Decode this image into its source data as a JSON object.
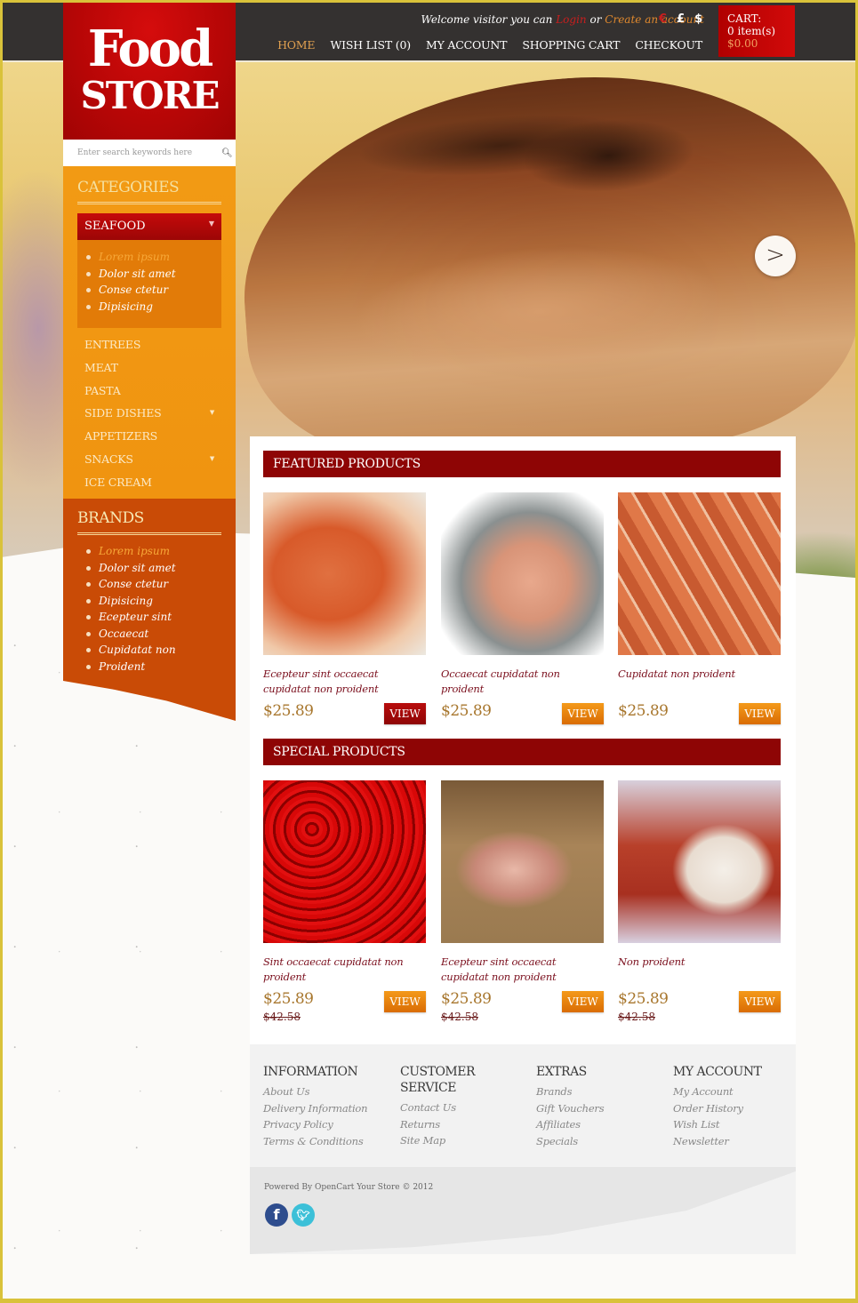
{
  "header": {
    "logo_line1": "Food",
    "logo_line2": "STORE",
    "welcome_text": "Welcome visitor you can",
    "login_link": "Login",
    "or_text": "or",
    "create_account_link": "Create an account",
    "currencies": [
      "€",
      "£",
      "$"
    ],
    "currency_colors": {
      "active": "#c81e1e",
      "inactive": "#ffffff"
    },
    "nav": [
      {
        "label": "HOME",
        "active": true
      },
      {
        "label": "WISH LIST (0)",
        "active": false
      },
      {
        "label": "MY ACCOUNT",
        "active": false
      },
      {
        "label": "SHOPPING CART",
        "active": false
      },
      {
        "label": "CHECKOUT",
        "active": false
      }
    ],
    "cart": {
      "label": "CART:",
      "items": "0 item(s)",
      "total": "$0.00"
    }
  },
  "search": {
    "placeholder": "Enter search keywords here",
    "icon": "search-icon"
  },
  "hero": {
    "next_label": ">"
  },
  "categories": {
    "title": "CATEGORIES",
    "active": {
      "label": "SEAFOOD",
      "icon": "chevron-down-icon"
    },
    "subitems": [
      "Lorem ipsum",
      "Dolor sit amet",
      "Conse ctetur",
      "Dipisicing"
    ],
    "items": [
      {
        "label": "ENTREES",
        "has_children": false
      },
      {
        "label": "MEAT",
        "has_children": false
      },
      {
        "label": "PASTA",
        "has_children": false
      },
      {
        "label": "SIDE DISHES",
        "has_children": true
      },
      {
        "label": "APPETIZERS",
        "has_children": false
      },
      {
        "label": "SNACKS",
        "has_children": true
      },
      {
        "label": "ICE CREAM",
        "has_children": false
      }
    ]
  },
  "brands": {
    "title": "BRANDS",
    "items": [
      "Lorem ipsum",
      "Dolor sit amet",
      "Conse ctetur",
      "Dipisicing",
      "Ecepteur sint",
      "Occaecat",
      "Cupidatat non",
      "Proident"
    ]
  },
  "featured": {
    "title": "FEATURED PRODUCTS",
    "products": [
      {
        "name": "Ecepteur sint occaecat cupidatat non proident",
        "price": "$25.89",
        "button": "VIEW",
        "image": "shrimp dish"
      },
      {
        "name": "Occaecat cupidatat non proident",
        "price": "$25.89",
        "button": "VIEW",
        "image": "grilled salmon steak"
      },
      {
        "name": "Cupidatat non proident",
        "price": "$25.89",
        "button": "VIEW",
        "image": "bacon wrapped rolls"
      }
    ]
  },
  "special": {
    "title": "SPECIAL PRODUCTS",
    "products": [
      {
        "name": "Sint occaecat cupidatat non proident",
        "price": "$25.89",
        "old_price": "$42.58",
        "button": "VIEW",
        "image": "red chili peppers"
      },
      {
        "name": "Ecepteur sint occaecat cupidatat non proident",
        "price": "$25.89",
        "old_price": "$42.58",
        "button": "VIEW",
        "image": "packaged sausage"
      },
      {
        "name": "Non proident",
        "price": "$25.89",
        "old_price": "$42.58",
        "button": "VIEW",
        "image": "cannelloni"
      }
    ]
  },
  "footer": {
    "columns": [
      {
        "title": "INFORMATION",
        "links": [
          "About Us",
          "Delivery Information",
          "Privacy Policy",
          "Terms & Conditions"
        ]
      },
      {
        "title": "CUSTOMER SERVICE",
        "links": [
          "Contact Us",
          "Returns",
          "Site Map"
        ]
      },
      {
        "title": "EXTRAS",
        "links": [
          "Brands",
          "Gift Vouchers",
          "Affiliates",
          "Specials"
        ]
      },
      {
        "title": "MY ACCOUNT",
        "links": [
          "My Account",
          "Order History",
          "Wish List",
          "Newsletter"
        ]
      }
    ],
    "powered": "Powered By OpenCart Your Store © 2012",
    "social": [
      {
        "name": "facebook",
        "glyph": "f"
      },
      {
        "name": "twitter",
        "glyph": "t"
      }
    ]
  },
  "colors": {
    "brand_red": "#b60606",
    "section_bar": "#8e0505",
    "categories_bg": "#f29a14",
    "brands_bg": "#c94b06",
    "topbar": "#343130",
    "price": "#a8772e",
    "view_button": "#e8820c"
  }
}
